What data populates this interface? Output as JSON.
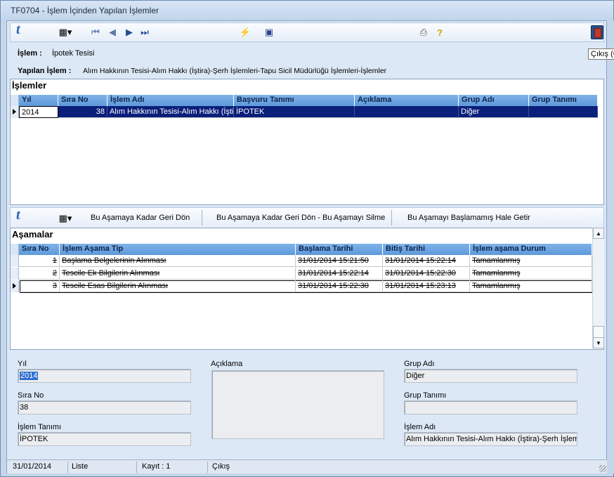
{
  "window": {
    "title": "TF0704 - İşlem İçinden Yapılan İşlemler"
  },
  "toolbar": {
    "tooltip": "Çıkış (C"
  },
  "header": {
    "islem_label": "İşlem :",
    "islem_value": "İpotek Tesisi",
    "yapilan_label": "Yapılan İşlem :",
    "yapilan_value": "Alım Hakkının Tesisi-Alım Hakkı (İştira)-Şerh İşlemleri-Tapu Sicil Müdürlüğü İşlemleri-İşlemler"
  },
  "islemler": {
    "title": "İşlemler",
    "columns": [
      "Yıl",
      "Sıra No",
      "İşlem Adı",
      "Başvuru Tanımı",
      "Açıklama",
      "Grup Adı",
      "Grup Tanımı"
    ],
    "rows": [
      {
        "yil": "2014",
        "sira": "38",
        "adi": "Alım Hakkının Tesisi-Alım Hakkı (İştira",
        "basvuru": "İPOTEK",
        "aciklama": "",
        "grup_adi": "Diğer",
        "grup_tanimi": ""
      }
    ]
  },
  "midbar": {
    "btn1": "Bu Aşamaya Kadar Geri Dön",
    "btn2": "Bu Aşamaya Kadar Geri Dön - Bu Aşamayı Silme",
    "btn3": "Bu Aşamayı Başlamamış Hale Getir"
  },
  "asamalar": {
    "title": "Aşamalar",
    "columns": [
      "Sıra No",
      "İşlem Aşama Tip",
      "Başlama Tarihi",
      "Bitiş Tarihi",
      "İşlem aşama Durum"
    ],
    "rows": [
      {
        "sira": "1",
        "tip": "Başlama Belgelerinin Alınması",
        "baslama": "31/01/2014 15:21:50",
        "bitis": "31/01/2014 15:22:14",
        "durum": "Tamamlanmış"
      },
      {
        "sira": "2",
        "tip": "Tescile Ek Bilgilerin Alınması",
        "baslama": "31/01/2014 15:22:14",
        "bitis": "31/01/2014 15:22:30",
        "durum": "Tamamlanmış"
      },
      {
        "sira": "3",
        "tip": "Tescile Esas Bilgilerin Alınması",
        "baslama": "31/01/2014 15:22:30",
        "bitis": "31/01/2014 15:23:13",
        "durum": "Tamamlanmış"
      }
    ]
  },
  "detail": {
    "yil_label": "Yıl",
    "yil_value": "2014",
    "sira_label": "Sıra No",
    "sira_value": "38",
    "tanim_label": "İşlem Tanımı",
    "tanim_value": "İPOTEK",
    "aciklama_label": "Açıklama",
    "aciklama_value": "",
    "grup_adi_label": "Grup Adı",
    "grup_adi_value": "Diğer",
    "grup_tanimi_label": "Grup Tanımı",
    "grup_tanimi_value": "",
    "islem_adi_label": "İşlem Adı",
    "islem_adi_value": "Alım Hakkının Tesisi-Alım Hakkı (İştira)-Şerh İşlemler"
  },
  "status": {
    "date": "31/01/2014",
    "mode": "Liste",
    "kayit": "Kayıt : 1",
    "cikis": "Çıkış"
  }
}
